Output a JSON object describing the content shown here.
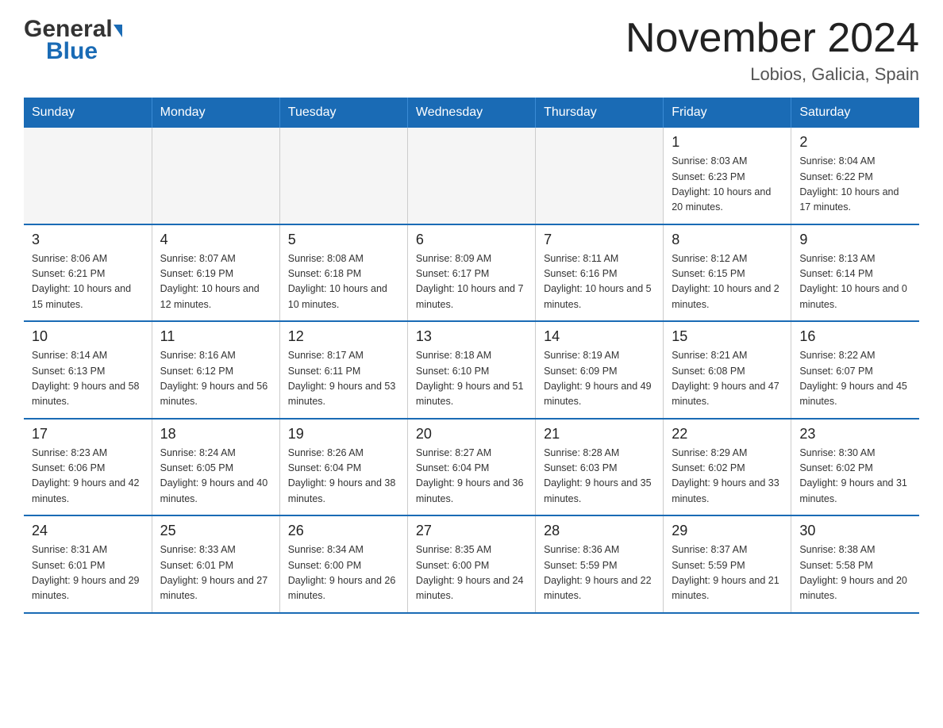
{
  "header": {
    "logo_general": "General",
    "logo_blue": "Blue",
    "month_title": "November 2024",
    "location": "Lobios, Galicia, Spain"
  },
  "weekdays": [
    "Sunday",
    "Monday",
    "Tuesday",
    "Wednesday",
    "Thursday",
    "Friday",
    "Saturday"
  ],
  "weeks": [
    [
      {
        "day": "",
        "empty": true
      },
      {
        "day": "",
        "empty": true
      },
      {
        "day": "",
        "empty": true
      },
      {
        "day": "",
        "empty": true
      },
      {
        "day": "",
        "empty": true
      },
      {
        "day": "1",
        "sunrise": "8:03 AM",
        "sunset": "6:23 PM",
        "daylight": "10 hours and 20 minutes."
      },
      {
        "day": "2",
        "sunrise": "8:04 AM",
        "sunset": "6:22 PM",
        "daylight": "10 hours and 17 minutes."
      }
    ],
    [
      {
        "day": "3",
        "sunrise": "8:06 AM",
        "sunset": "6:21 PM",
        "daylight": "10 hours and 15 minutes."
      },
      {
        "day": "4",
        "sunrise": "8:07 AM",
        "sunset": "6:19 PM",
        "daylight": "10 hours and 12 minutes."
      },
      {
        "day": "5",
        "sunrise": "8:08 AM",
        "sunset": "6:18 PM",
        "daylight": "10 hours and 10 minutes."
      },
      {
        "day": "6",
        "sunrise": "8:09 AM",
        "sunset": "6:17 PM",
        "daylight": "10 hours and 7 minutes."
      },
      {
        "day": "7",
        "sunrise": "8:11 AM",
        "sunset": "6:16 PM",
        "daylight": "10 hours and 5 minutes."
      },
      {
        "day": "8",
        "sunrise": "8:12 AM",
        "sunset": "6:15 PM",
        "daylight": "10 hours and 2 minutes."
      },
      {
        "day": "9",
        "sunrise": "8:13 AM",
        "sunset": "6:14 PM",
        "daylight": "10 hours and 0 minutes."
      }
    ],
    [
      {
        "day": "10",
        "sunrise": "8:14 AM",
        "sunset": "6:13 PM",
        "daylight": "9 hours and 58 minutes."
      },
      {
        "day": "11",
        "sunrise": "8:16 AM",
        "sunset": "6:12 PM",
        "daylight": "9 hours and 56 minutes."
      },
      {
        "day": "12",
        "sunrise": "8:17 AM",
        "sunset": "6:11 PM",
        "daylight": "9 hours and 53 minutes."
      },
      {
        "day": "13",
        "sunrise": "8:18 AM",
        "sunset": "6:10 PM",
        "daylight": "9 hours and 51 minutes."
      },
      {
        "day": "14",
        "sunrise": "8:19 AM",
        "sunset": "6:09 PM",
        "daylight": "9 hours and 49 minutes."
      },
      {
        "day": "15",
        "sunrise": "8:21 AM",
        "sunset": "6:08 PM",
        "daylight": "9 hours and 47 minutes."
      },
      {
        "day": "16",
        "sunrise": "8:22 AM",
        "sunset": "6:07 PM",
        "daylight": "9 hours and 45 minutes."
      }
    ],
    [
      {
        "day": "17",
        "sunrise": "8:23 AM",
        "sunset": "6:06 PM",
        "daylight": "9 hours and 42 minutes."
      },
      {
        "day": "18",
        "sunrise": "8:24 AM",
        "sunset": "6:05 PM",
        "daylight": "9 hours and 40 minutes."
      },
      {
        "day": "19",
        "sunrise": "8:26 AM",
        "sunset": "6:04 PM",
        "daylight": "9 hours and 38 minutes."
      },
      {
        "day": "20",
        "sunrise": "8:27 AM",
        "sunset": "6:04 PM",
        "daylight": "9 hours and 36 minutes."
      },
      {
        "day": "21",
        "sunrise": "8:28 AM",
        "sunset": "6:03 PM",
        "daylight": "9 hours and 35 minutes."
      },
      {
        "day": "22",
        "sunrise": "8:29 AM",
        "sunset": "6:02 PM",
        "daylight": "9 hours and 33 minutes."
      },
      {
        "day": "23",
        "sunrise": "8:30 AM",
        "sunset": "6:02 PM",
        "daylight": "9 hours and 31 minutes."
      }
    ],
    [
      {
        "day": "24",
        "sunrise": "8:31 AM",
        "sunset": "6:01 PM",
        "daylight": "9 hours and 29 minutes."
      },
      {
        "day": "25",
        "sunrise": "8:33 AM",
        "sunset": "6:01 PM",
        "daylight": "9 hours and 27 minutes."
      },
      {
        "day": "26",
        "sunrise": "8:34 AM",
        "sunset": "6:00 PM",
        "daylight": "9 hours and 26 minutes."
      },
      {
        "day": "27",
        "sunrise": "8:35 AM",
        "sunset": "6:00 PM",
        "daylight": "9 hours and 24 minutes."
      },
      {
        "day": "28",
        "sunrise": "8:36 AM",
        "sunset": "5:59 PM",
        "daylight": "9 hours and 22 minutes."
      },
      {
        "day": "29",
        "sunrise": "8:37 AM",
        "sunset": "5:59 PM",
        "daylight": "9 hours and 21 minutes."
      },
      {
        "day": "30",
        "sunrise": "8:38 AM",
        "sunset": "5:58 PM",
        "daylight": "9 hours and 20 minutes."
      }
    ]
  ],
  "labels": {
    "sunrise": "Sunrise:",
    "sunset": "Sunset:",
    "daylight": "Daylight:"
  }
}
